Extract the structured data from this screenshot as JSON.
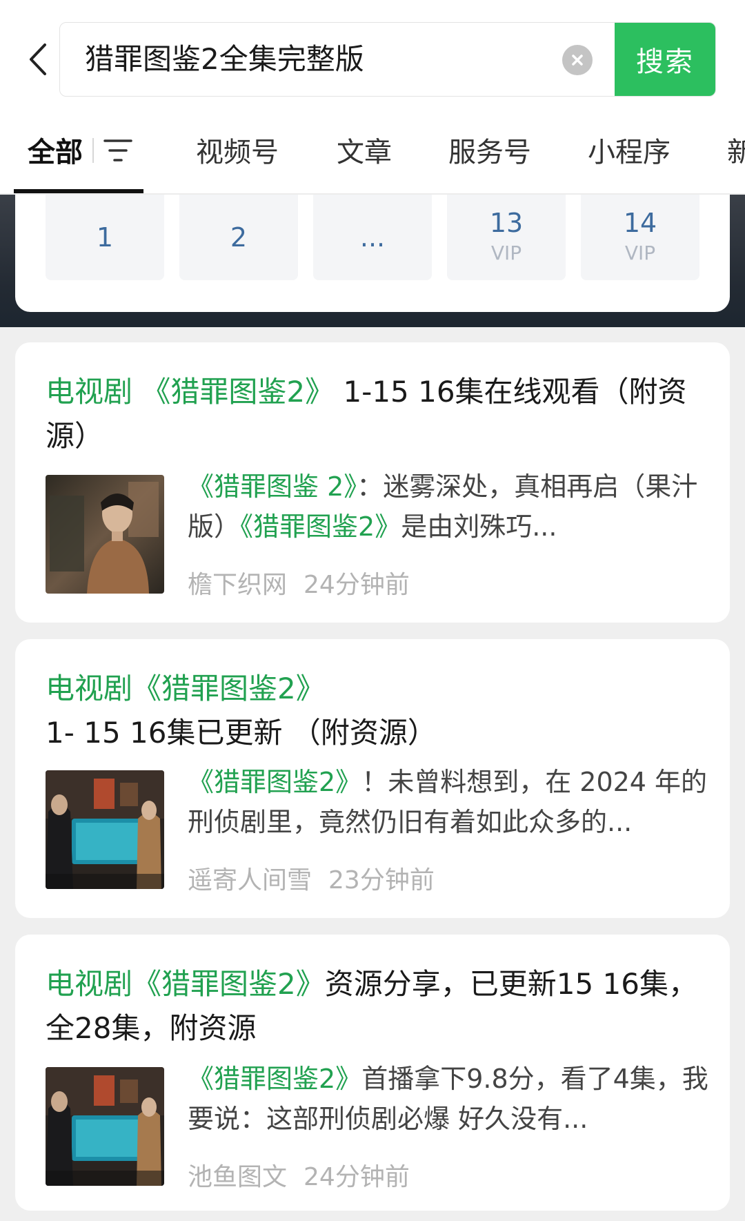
{
  "search": {
    "query": "猎罪图鉴2全集完整版",
    "button_label": "搜索"
  },
  "tabs": [
    {
      "label": "全部",
      "active": true
    },
    {
      "label": "视频号"
    },
    {
      "label": "文章"
    },
    {
      "label": "服务号"
    },
    {
      "label": "小程序"
    },
    {
      "label": "新"
    }
  ],
  "pagination": [
    {
      "num": "1",
      "vip": ""
    },
    {
      "num": "2",
      "vip": ""
    },
    {
      "num": "...",
      "vip": ""
    },
    {
      "num": "13",
      "vip": "VIP"
    },
    {
      "num": "14",
      "vip": "VIP"
    }
  ],
  "results": [
    {
      "title_pre": "电视剧 ",
      "title_hl": "《猎罪图鉴2》",
      "title_post": " 1-15 16集在线观看（附资源）",
      "snippet_hl1": "《猎罪图鉴 2》",
      "snippet_mid": "：迷雾深处，真相再启（果汁版）",
      "snippet_hl2": "《猎罪图鉴2》",
      "snippet_post": "是由刘殊巧...",
      "source": "檐下织网",
      "time": "24分钟前"
    },
    {
      "title_pre": "电视剧",
      "title_hl": "《猎罪图鉴2》",
      "title_post": "1- 15 16集已更新 （附资源）",
      "snippet_hl1": "《猎罪图鉴2》",
      "snippet_mid": "！未曾料想到，在 2024 年的刑侦剧里，竟然仍旧有着如此众多的...",
      "snippet_hl2": "",
      "snippet_post": "",
      "source": "遥寄人间雪",
      "time": "23分钟前"
    },
    {
      "title_pre": "电视剧",
      "title_hl": "《猎罪图鉴2》",
      "title_post": "资源分享，已更新15 16集，全28集，附资源",
      "snippet_hl1": "《猎罪图鉴2》",
      "snippet_mid": "首播拿下9.8分，看了4集，我要说：这部刑侦剧必爆 好久没有...",
      "snippet_hl2": "",
      "snippet_post": "",
      "source": "池鱼图文",
      "time": "24分钟前"
    }
  ],
  "colors": {
    "accent": "#2cbf5f",
    "highlight": "#21a150",
    "page_link": "#3d6b9e"
  }
}
